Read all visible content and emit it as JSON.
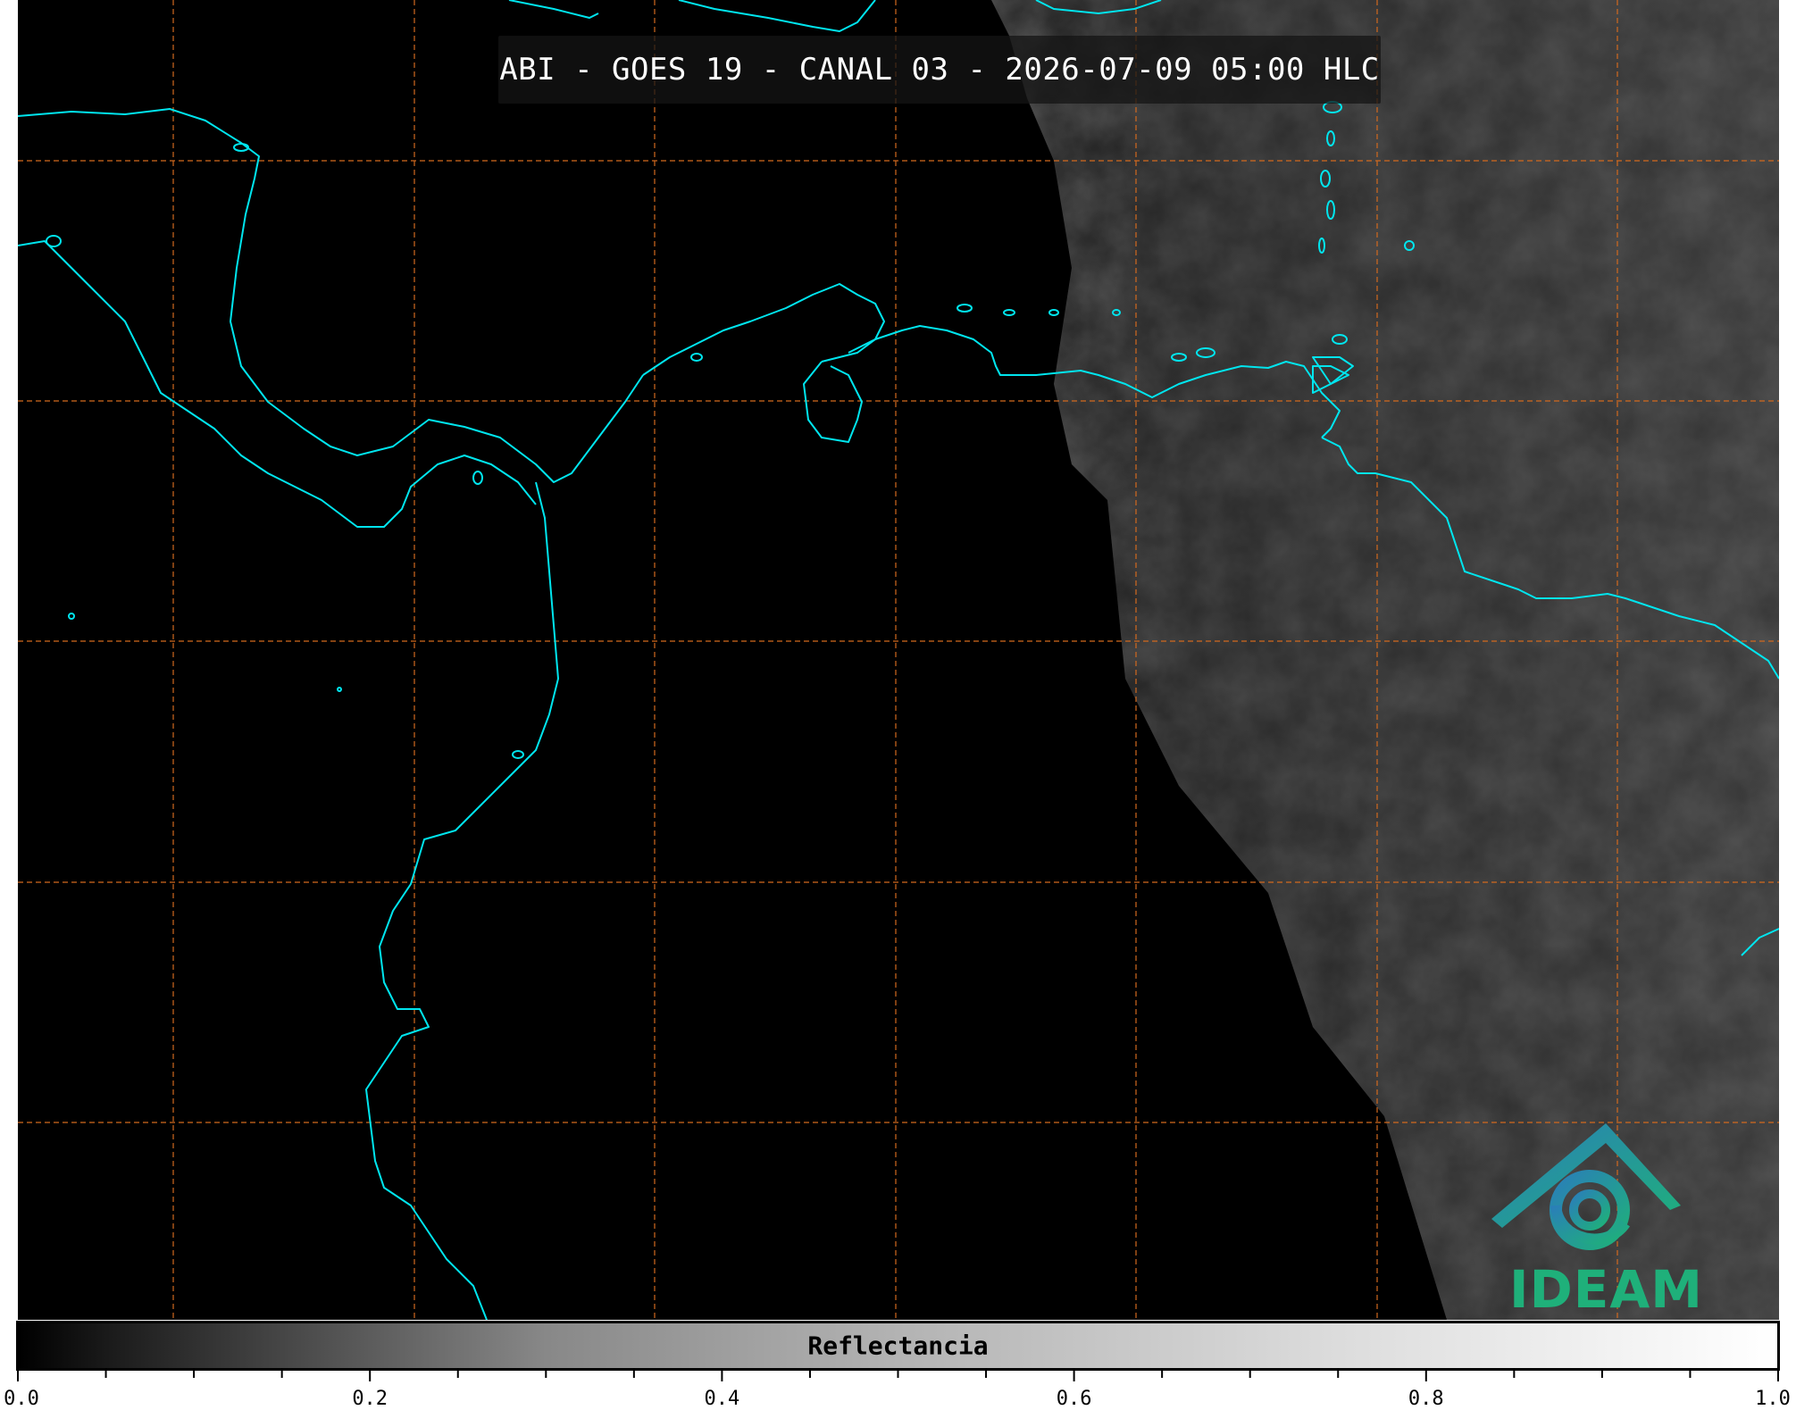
{
  "title": "ABI - GOES 19 - CANAL 03 - 2026-07-09 05:00 HLC",
  "logo_text": "IDEAM",
  "colorbar": {
    "label": "Reflectancia",
    "ticks": [
      "0.0",
      "0.2",
      "0.4",
      "0.6",
      "0.8",
      "1.0"
    ],
    "range": [
      0.0,
      1.0
    ]
  },
  "colors": {
    "coastline": "#00e5ee",
    "gridline": "#d2691e",
    "logo_teal": "#1fb07a",
    "logo_blue": "#2a7fb8"
  },
  "icons": [
    "ideam-logo-icon"
  ]
}
